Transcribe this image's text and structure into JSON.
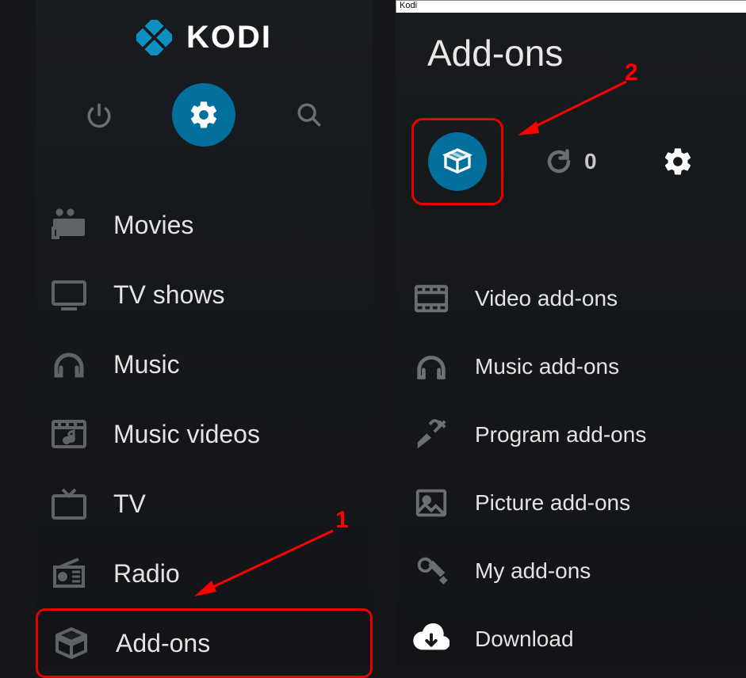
{
  "app_name": "KODI",
  "window_title": "Kodi",
  "sidebar": {
    "items": [
      {
        "label": "Movies"
      },
      {
        "label": "TV shows"
      },
      {
        "label": "Music"
      },
      {
        "label": "Music videos"
      },
      {
        "label": "TV"
      },
      {
        "label": "Radio"
      },
      {
        "label": "Add-ons"
      }
    ]
  },
  "addons_panel": {
    "title": "Add-ons",
    "update_count": "0",
    "categories": [
      {
        "label": "Video add-ons"
      },
      {
        "label": "Music add-ons"
      },
      {
        "label": "Program add-ons"
      },
      {
        "label": "Picture add-ons"
      },
      {
        "label": "My add-ons"
      },
      {
        "label": "Download"
      }
    ]
  },
  "annotations": {
    "step1": "1",
    "step2": "2"
  },
  "colors": {
    "accent": "#026f9c",
    "highlight": "#e60000",
    "bg": "#141619"
  }
}
